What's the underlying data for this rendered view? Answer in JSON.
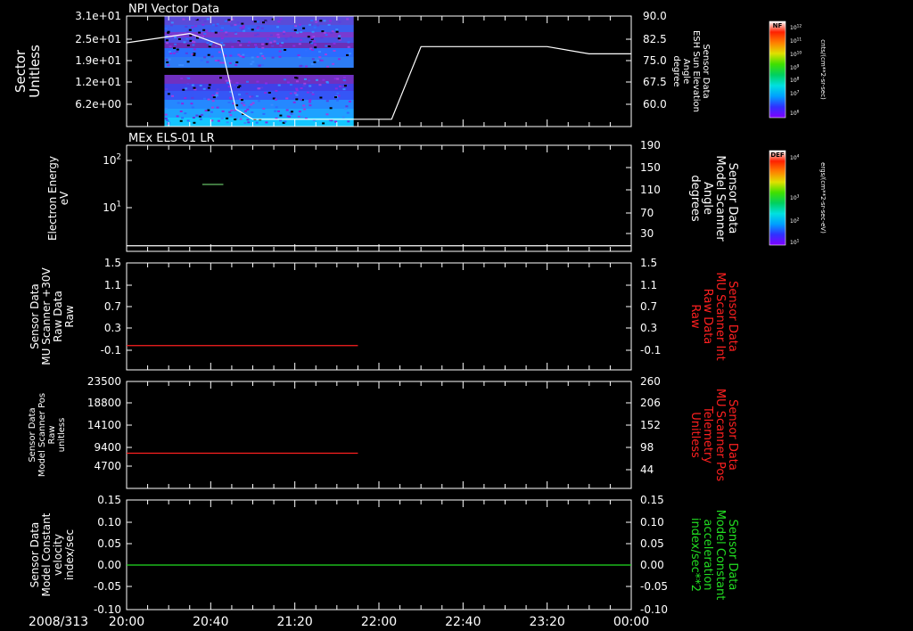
{
  "date_label": "2008/313",
  "x_ticks": [
    "20:00",
    "20:40",
    "21:20",
    "22:00",
    "22:40",
    "23:20",
    "00:00"
  ],
  "colorbars": [
    {
      "label": "NF",
      "units": "cnts/(cm**2-sr-sec)",
      "ticks": [
        "10^12",
        "10^11",
        "10^10",
        "10^9",
        "10^8",
        "10^7",
        "10^6"
      ]
    },
    {
      "label": "DEF",
      "units": "ergs/(cm**2-sr-sec-eV)",
      "ticks": [
        "10^4",
        "10^3",
        "10^2",
        "10^1"
      ]
    }
  ],
  "colors": {
    "white": "#ffffff",
    "red": "#ff2020",
    "green": "#22dd22",
    "bg": "#000000"
  },
  "chart_data": [
    {
      "type": "heatmap",
      "title": "NPI Vector Data",
      "ylabel_left": [
        "Sector",
        "Unitless"
      ],
      "ylabel_right": [
        "Sensor Data",
        "ESH Sun Elevation",
        "Angle",
        "degree"
      ],
      "left_ticks": [
        "3.1e+01",
        "2.5e+01",
        "1.9e+01",
        "1.2e+01",
        "6.2e+00"
      ],
      "right_ticks": [
        "90.0",
        "82.5",
        "75.0",
        "67.5",
        "60.0"
      ],
      "ylim_left": [
        0,
        31
      ],
      "ylim_right": [
        52,
        90
      ],
      "spectrogram_time_range": [
        "20:18",
        "21:48"
      ],
      "line_series": {
        "name": "Sensor Data ESH Sun Elevation Angle",
        "x": [
          "20:00",
          "20:30",
          "20:45",
          "20:52",
          "21:00",
          "21:40",
          "22:06",
          "22:20",
          "22:40",
          "23:20",
          "23:40",
          "00:00"
        ],
        "y": [
          80.8,
          84.0,
          80.0,
          58.0,
          54.5,
          54.5,
          54.5,
          79.5,
          79.5,
          79.5,
          77.0,
          77.0
        ]
      }
    },
    {
      "type": "line",
      "title": "MEx ELS-01 LR",
      "ylabel_left": [
        "Electron Energy",
        "eV"
      ],
      "ylabel_right": [
        "Sensor Data",
        "Model Scanner",
        "Angle",
        "degrees"
      ],
      "left_ticks": [
        "10^2",
        "10^1"
      ],
      "right_ticks": [
        "190",
        "150",
        "110",
        "70",
        "30"
      ],
      "ylim_right": [
        0,
        190
      ],
      "series": [
        {
          "name": "Sensor Data Model Scanner Angle",
          "x": [
            "20:00",
            "00:00"
          ],
          "y": [
            10,
            10
          ]
        },
        {
          "name": "Electron Energy",
          "x": [
            "20:36",
            "20:46"
          ],
          "y": [
            31,
            31
          ]
        }
      ]
    },
    {
      "type": "line",
      "ylabel_left": [
        "Sensor Data",
        "MU Scanner +30V",
        "Raw Data",
        "Raw"
      ],
      "ylabel_right": [
        "Sensor Data",
        "MU Scanner Int",
        "Raw Data",
        "Raw"
      ],
      "left_ticks": [
        "1.5",
        "1.1",
        "0.7",
        "0.3",
        "-0.1"
      ],
      "right_ticks": [
        "1.5",
        "1.1",
        "0.7",
        "0.3",
        "-0.1"
      ],
      "ylim": [
        -0.3,
        1.5
      ],
      "series": [
        {
          "name": "Sensor Data MU Scanner Int Raw Data",
          "x": [
            "20:00",
            "21:50"
          ],
          "y": [
            0.0,
            0.0
          ]
        }
      ]
    },
    {
      "type": "line",
      "ylabel_left": [
        "Sensor Data",
        "Model Scanner Pos",
        "Raw",
        "unitless"
      ],
      "ylabel_right": [
        "Sensor Data",
        "MU Scanner Pos",
        "Telemetry",
        "Unitless"
      ],
      "left_ticks": [
        "23500",
        "18800",
        "14100",
        "9400",
        "4700"
      ],
      "right_ticks": [
        "260",
        "206",
        "152",
        "98",
        "44"
      ],
      "ylim_left": [
        0,
        23500
      ],
      "ylim_right": [
        0,
        260
      ],
      "series": [
        {
          "name": "Sensor Data MU Scanner Pos Telemetry",
          "x": [
            "20:00",
            "21:50"
          ],
          "y": [
            84,
            84
          ]
        }
      ]
    },
    {
      "type": "line",
      "ylabel_left": [
        "Sensor Data",
        "Model Constant",
        "velocity",
        "index/sec"
      ],
      "ylabel_right": [
        "Sensor Data",
        "Model Constant",
        "acceleration",
        "index/sec**2"
      ],
      "left_ticks": [
        "0.15",
        "0.10",
        "0.05",
        "0.00",
        "-0.05",
        "-0.10"
      ],
      "right_ticks": [
        "0.15",
        "0.10",
        "0.05",
        "0.00",
        "-0.05",
        "-0.10"
      ],
      "ylim": [
        -0.1,
        0.15
      ],
      "series": [
        {
          "name": "Sensor Data Model Constant acceleration",
          "x": [
            "20:00",
            "00:00"
          ],
          "y": [
            0.0,
            0.0
          ]
        }
      ]
    }
  ]
}
